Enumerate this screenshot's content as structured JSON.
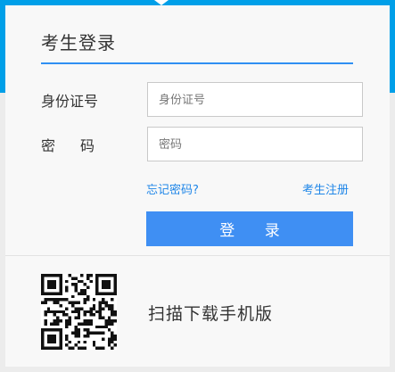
{
  "login": {
    "title": "考生登录",
    "id_label": "身份证号",
    "id_placeholder": "身份证号",
    "password_label": "密码",
    "password_placeholder": "密码",
    "forgot_password": "忘记密码?",
    "register": "考生注册",
    "login_button": "登 录"
  },
  "app_download": {
    "scan_text": "扫描下载手机版"
  },
  "colors": {
    "header_band": "#009fe8",
    "accent": "#2f8ff3",
    "button": "#3f8ff3",
    "link": "#1f86e8"
  }
}
